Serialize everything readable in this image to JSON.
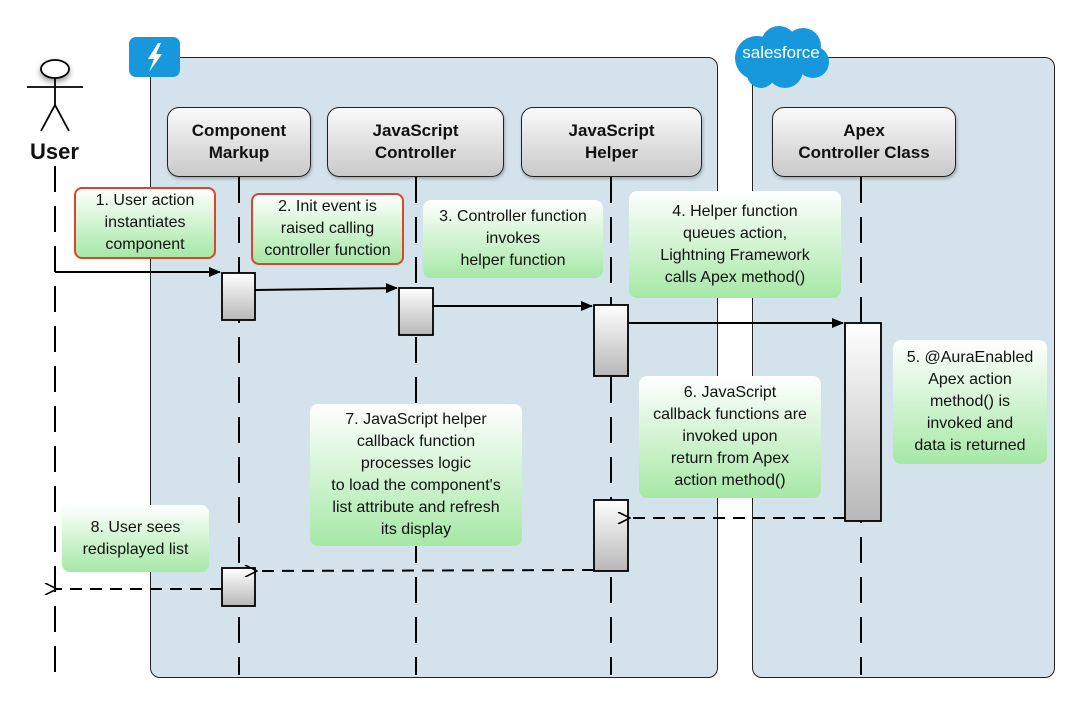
{
  "actor": {
    "label": "User"
  },
  "groups": [
    {
      "id": "lightning",
      "logo": "lightning-bolt-icon",
      "logo_color": "#1798dc"
    },
    {
      "id": "salesforce",
      "logo": "salesforce-cloud-logo",
      "logo_text": "salesforce",
      "logo_color": "#1798dc"
    }
  ],
  "lifelines": [
    {
      "label": "Component\nMarkup"
    },
    {
      "label": "JavaScript\nController"
    },
    {
      "label": "JavaScript\nHelper"
    },
    {
      "label": "Apex\nController Class"
    }
  ],
  "notes": [
    {
      "step": 1,
      "text": "1. User action\ninstantiates\ncomponent",
      "border": "#d9472b"
    },
    {
      "step": 2,
      "text": "2. Init event is\nraised calling\ncontroller function",
      "border": "#d9472b"
    },
    {
      "step": 3,
      "text": "3. Controller function\ninvokes\nhelper function"
    },
    {
      "step": 4,
      "text": "4. Helper function\nqueues action,\nLightning Framework\ncalls Apex method()"
    },
    {
      "step": 5,
      "text": "5. @AuraEnabled\nApex action\nmethod() is\ninvoked and\ndata is returned"
    },
    {
      "step": 6,
      "text": "6. JavaScript\ncallback functions are\ninvoked upon\nreturn from Apex\naction method()"
    },
    {
      "step": 7,
      "text": "7. JavaScript helper\ncallback function\nprocesses logic\nto load the component's\nlist attribute and refresh\nits display"
    },
    {
      "step": 8,
      "text": "8. User sees\nredisplayed list"
    }
  ],
  "messages": [
    {
      "from": "User",
      "to": "Component Markup",
      "type": "sync"
    },
    {
      "from": "Component Markup",
      "to": "JavaScript Controller",
      "type": "sync"
    },
    {
      "from": "JavaScript Controller",
      "to": "JavaScript Helper",
      "type": "sync"
    },
    {
      "from": "JavaScript Helper",
      "to": "Apex Controller Class",
      "type": "sync"
    },
    {
      "from": "Apex Controller Class",
      "to": "JavaScript Helper",
      "type": "return"
    },
    {
      "from": "JavaScript Helper",
      "to": "Component Markup",
      "type": "return"
    },
    {
      "from": "Component Markup",
      "to": "User",
      "type": "return"
    }
  ],
  "colors": {
    "panel": "#d4e3eb",
    "note_green": "#a6e8a6",
    "note_border_red": "#d9472b",
    "brand_blue": "#1798dc"
  }
}
